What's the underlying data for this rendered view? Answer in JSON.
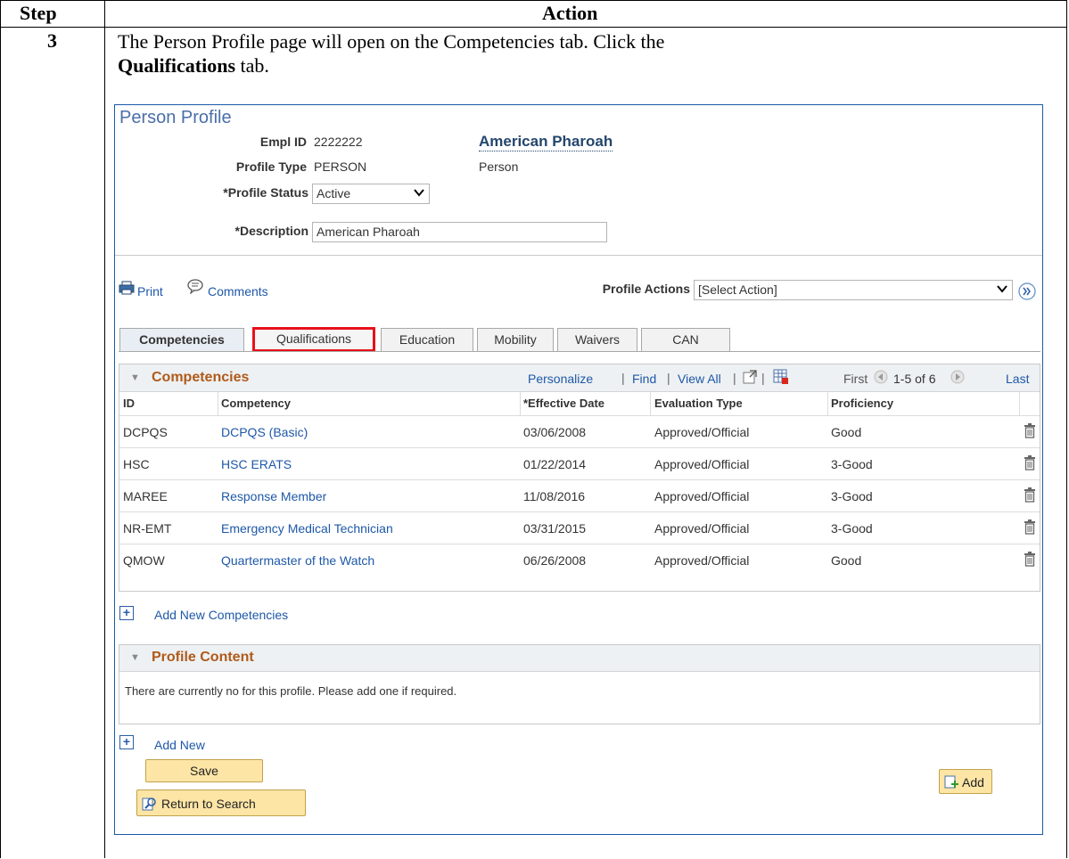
{
  "doc": {
    "col_step_header": "Step",
    "col_action_header": "Action",
    "step_number": "3",
    "instruction_line1": "The Person Profile page will open on the Competencies tab. Click the",
    "instruction_bold": "Qualifications",
    "instruction_tail": " tab."
  },
  "page": {
    "title": "Person Profile",
    "empl_id_label": "Empl ID",
    "empl_id_value": "2222222",
    "person_name": "American Pharoah",
    "profile_type_label": "Profile Type",
    "profile_type_value": "PERSON",
    "profile_type_desc": "Person",
    "profile_status_label": "*Profile Status",
    "profile_status_value": "Active",
    "description_label": "*Description",
    "description_value": "American Pharoah"
  },
  "toolbar": {
    "print_label": "Print",
    "comments_label": "Comments",
    "profile_actions_label": "Profile Actions",
    "profile_actions_value": "[Select Action]"
  },
  "tabs": [
    {
      "label": "Competencies",
      "active": true
    },
    {
      "label": "Qualifications",
      "highlighted": true
    },
    {
      "label": "Education"
    },
    {
      "label": "Mobility"
    },
    {
      "label": "Waivers"
    },
    {
      "label": "CAN"
    }
  ],
  "competencies_grid": {
    "title": "Competencies",
    "personalize": "Personalize",
    "find": "Find",
    "view_all": "View All",
    "sep": "|",
    "first": "First",
    "range": "1-5 of 6",
    "last": "Last",
    "columns": [
      "ID",
      "Competency",
      "*Effective Date",
      "Evaluation Type",
      "Proficiency"
    ],
    "rows": [
      {
        "id": "DCPQS",
        "competency": "DCPQS (Basic)",
        "date": "03/06/2008",
        "eval": "Approved/Official",
        "prof": "Good"
      },
      {
        "id": "HSC",
        "competency": "HSC ERATS",
        "date": "01/22/2014",
        "eval": "Approved/Official",
        "prof": "3-Good"
      },
      {
        "id": "MAREE",
        "competency": "Response Member",
        "date": "11/08/2016",
        "eval": "Approved/Official",
        "prof": "3-Good"
      },
      {
        "id": "NR-EMT",
        "competency": "Emergency Medical Technician",
        "date": "03/31/2015",
        "eval": "Approved/Official",
        "prof": "3-Good"
      },
      {
        "id": "QMOW",
        "competency": "Quartermaster of the Watch",
        "date": "06/26/2008",
        "eval": "Approved/Official",
        "prof": "Good"
      }
    ],
    "add_new_label": "Add New Competencies"
  },
  "profile_content": {
    "title": "Profile Content",
    "message": "There are currently no  for this profile.  Please add one if required.",
    "add_new_label": "Add New"
  },
  "buttons": {
    "save": "Save",
    "return_to_search": "Return to Search",
    "add": "Add"
  },
  "colors": {
    "link": "#1e58a8",
    "grid_title": "#b05a1a",
    "highlight": "#e8101a",
    "button_fill": "#fde5a6"
  }
}
